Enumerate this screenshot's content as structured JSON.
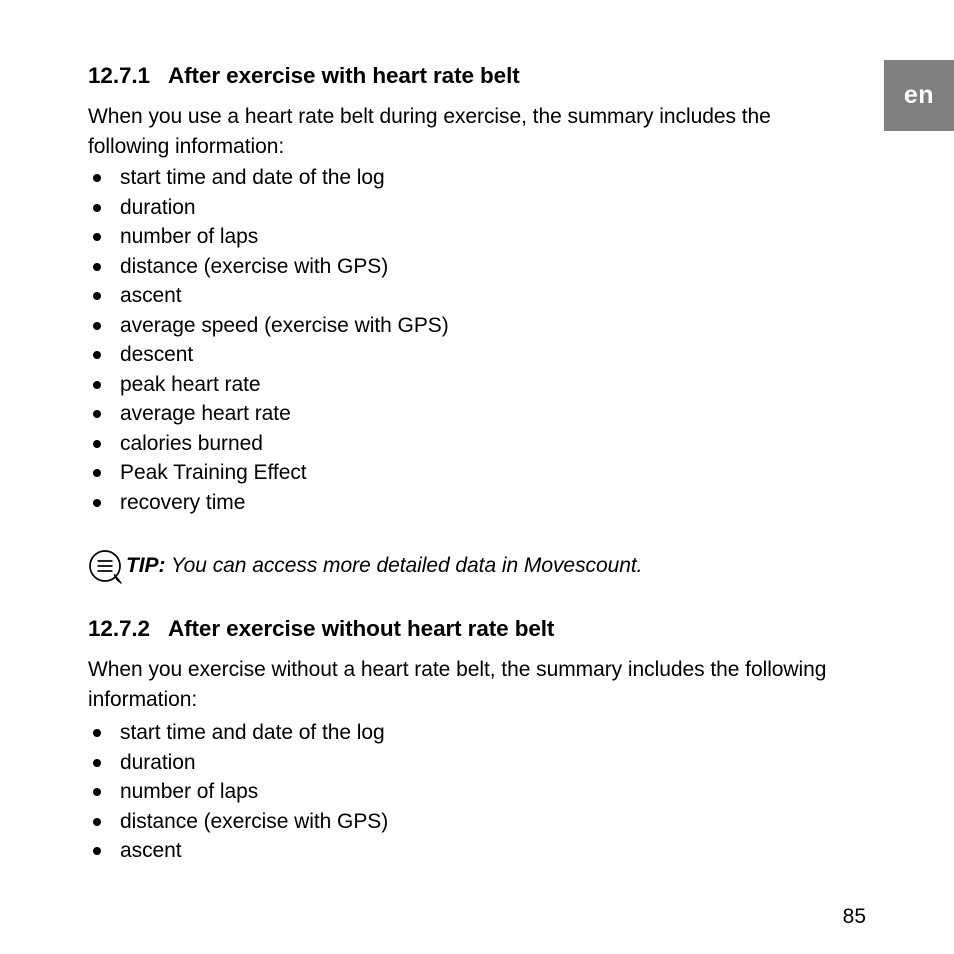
{
  "language_tab": {
    "label": "en"
  },
  "sections": [
    {
      "number": "12.7.1",
      "title": "After exercise with heart rate belt",
      "intro": "When you use a heart rate belt during exercise, the summary includes the following information:",
      "items": [
        "start time and date of the log",
        "duration",
        "number of laps",
        "distance (exercise with GPS)",
        "ascent",
        "average speed (exercise with GPS)",
        "descent",
        "peak heart rate",
        "average heart rate",
        "calories burned",
        "Peak Training Effect",
        "recovery time"
      ]
    },
    {
      "number": "12.7.2",
      "title": "After exercise without heart rate belt",
      "intro": "When you exercise without a heart rate belt, the summary includes the following information:",
      "items": [
        "start time and date of the log",
        "duration",
        "number of laps",
        "distance (exercise with GPS)",
        "ascent"
      ]
    }
  ],
  "tip": {
    "icon": "speech-bubble-icon",
    "label": "TIP:",
    "text": " You can access more detailed data in Movescount."
  },
  "page_number": "85",
  "colors": {
    "tab_background": "#808080",
    "tab_text": "#ffffff",
    "body_text": "#000000",
    "page_background": "#ffffff"
  }
}
